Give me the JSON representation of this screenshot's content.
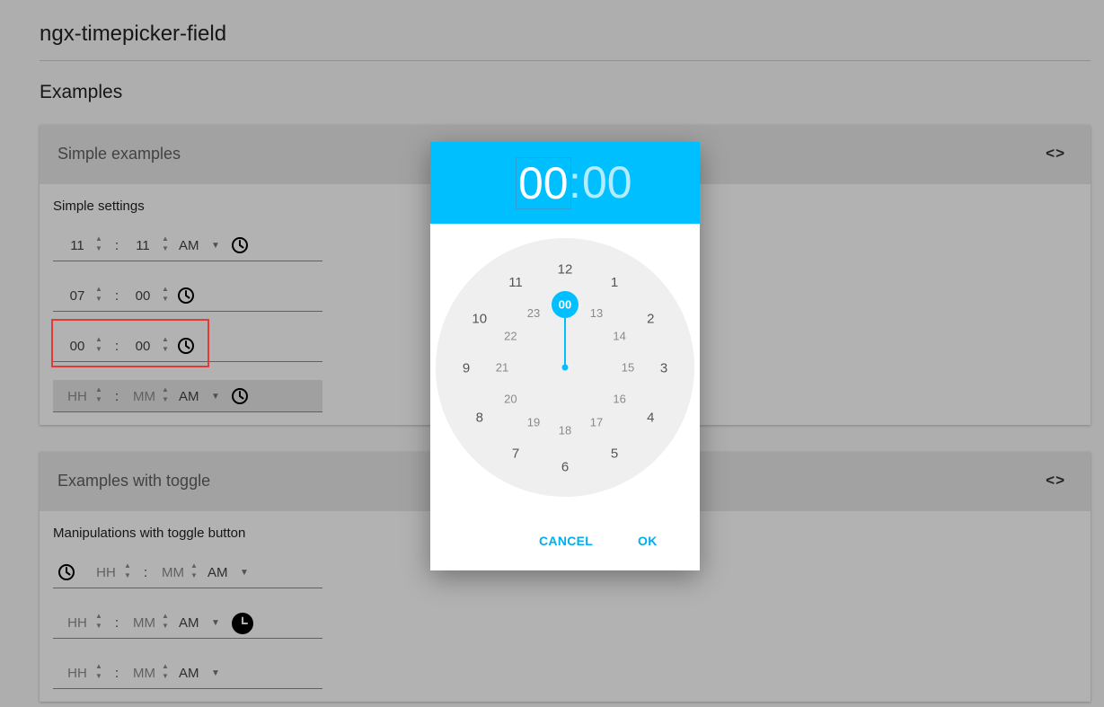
{
  "page": {
    "title": "ngx-timepicker-field",
    "section": "Examples"
  },
  "cards": {
    "simple": {
      "title": "Simple examples",
      "code_icon": "<>",
      "subtitle": "Simple settings",
      "rows": [
        {
          "hour": "11",
          "minute": "11",
          "ampm": "AM",
          "placeholder": false
        },
        {
          "hour": "07",
          "minute": "00",
          "placeholder": false
        },
        {
          "hour": "00",
          "minute": "00",
          "placeholder": false
        },
        {
          "hour": "HH",
          "minute": "MM",
          "ampm": "AM",
          "placeholder": true
        }
      ]
    },
    "toggle": {
      "title": "Examples with toggle",
      "code_icon": "<>",
      "subtitle": "Manipulations with toggle button",
      "rows": [
        {
          "hour": "HH",
          "minute": "MM",
          "ampm": "AM",
          "placeholder": true
        },
        {
          "hour": "HH",
          "minute": "MM",
          "ampm": "AM",
          "placeholder": true
        },
        {
          "hour": "HH",
          "minute": "MM",
          "ampm": "AM",
          "placeholder": true
        }
      ]
    }
  },
  "spinner": {
    "up": "▲",
    "down": "▼"
  },
  "separator": ":",
  "caret": "▼",
  "dialog": {
    "hour": "00",
    "colon": ":",
    "minute": "00",
    "outer_numbers": [
      "12",
      "1",
      "2",
      "3",
      "4",
      "5",
      "6",
      "7",
      "8",
      "9",
      "10",
      "11"
    ],
    "inner_numbers": [
      "00",
      "13",
      "14",
      "15",
      "16",
      "17",
      "18",
      "19",
      "20",
      "21",
      "22",
      "23"
    ],
    "selected": "00",
    "cancel_label": "CANCEL",
    "ok_label": "OK"
  },
  "colors": {
    "accent": "#00bfff",
    "highlight_border": "#e53935",
    "dial": "#efefef"
  },
  "icons": {
    "clock": "clock-outline-icon",
    "clock_filled": "clock-filled-icon",
    "code": "code-brackets-icon"
  }
}
